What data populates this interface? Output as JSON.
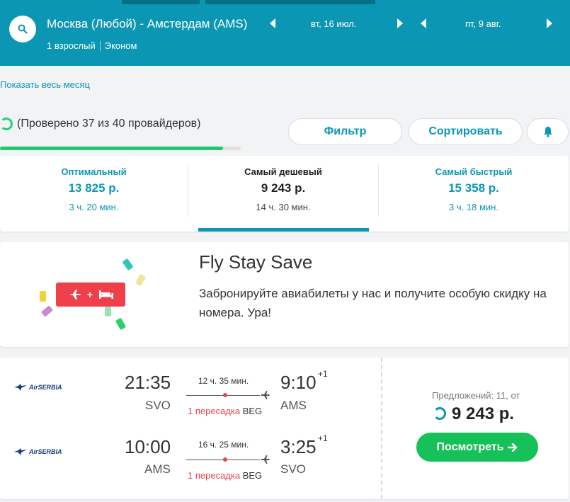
{
  "header": {
    "route": "Москва (Любой) - Амстердам (AMS)",
    "passengers": "1 взрослый",
    "cabin": "Эконом",
    "depart_date": "вт, 16 июл.",
    "return_date": "пт, 9 авг.",
    "accent_color": "#0b97b4"
  },
  "month_link": "Показать весь месяц",
  "progress": {
    "text": "(Проверено 37 из 40 провайдеров)",
    "fraction": 0.925
  },
  "actions": {
    "filter": "Фильтр",
    "sort": "Сортировать",
    "alert_icon": "bell-icon"
  },
  "sort_tabs": [
    {
      "title": "Оптимальный",
      "price": "13 825 р.",
      "duration": "3 ч. 20 мин."
    },
    {
      "title": "Самый дешевый",
      "price": "9 243 р.",
      "duration": "14 ч. 30 мин."
    },
    {
      "title": "Самый быстрый",
      "price": "15 358 р.",
      "duration": "3 ч. 18 мин."
    }
  ],
  "promo": {
    "title": "Fly Stay Save",
    "text": "Забронируйте авиабилеты у нас и получите особую скидку на номера. Ура!",
    "badge_plus": "+"
  },
  "result": {
    "legs": [
      {
        "airline": "AirSERBIA",
        "dep_time": "21:35",
        "dep_code": "SVO",
        "duration": "12 ч. 35 мин.",
        "stops_label": "1 пересадка",
        "stop_code": "BEG",
        "arr_time": "9:10",
        "arr_offset": "+1",
        "arr_code": "AMS"
      },
      {
        "airline": "AirSERBIA",
        "dep_time": "10:00",
        "dep_code": "AMS",
        "duration": "16 ч. 25 мин.",
        "stops_label": "1 пересадка",
        "stop_code": "BEG",
        "arr_time": "3:25",
        "arr_offset": "+1",
        "arr_code": "SVO"
      }
    ],
    "offers": "Предложений: 11, от",
    "price": "9 243 р.",
    "view_button": "Посмотреть"
  }
}
